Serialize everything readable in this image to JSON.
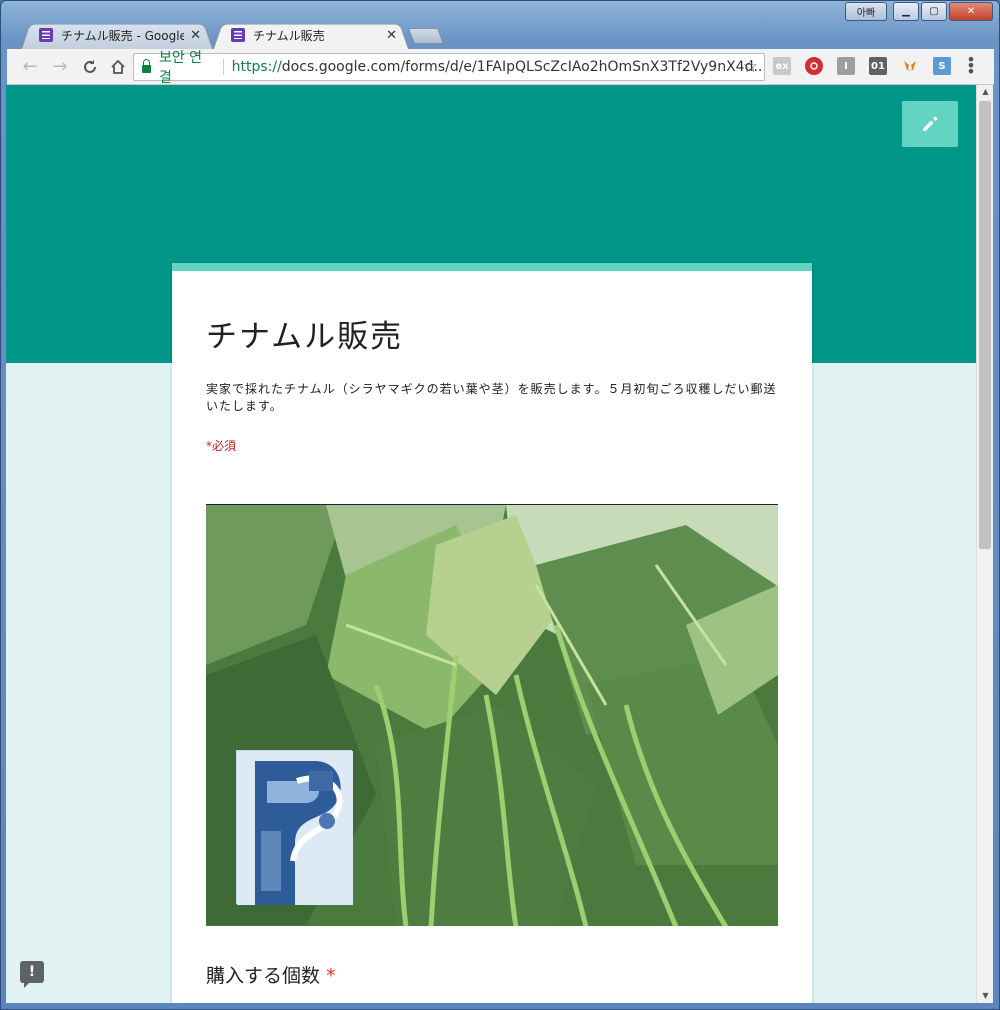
{
  "window": {
    "user_label": "아빠",
    "minimize_label": "▁",
    "maximize_label": "▢",
    "close_label": "✕"
  },
  "tabs": [
    {
      "title": "チナムル販売 - Google フ",
      "active": false
    },
    {
      "title": "チナムル販売",
      "active": true
    }
  ],
  "toolbar": {
    "secure_label": "보안 연결",
    "url_scheme": "https://",
    "url_rest": "docs.google.com/forms/d/e/1FAIpQLScZcIAo2hOmSnX3Tf2Vy9nX4d..."
  },
  "extensions": [
    {
      "name": "ex-icon",
      "label": "ex",
      "color": "#c8c8c8"
    },
    {
      "name": "lastpass-icon",
      "label": "",
      "color": "#d32f2f"
    },
    {
      "name": "i-icon",
      "label": "I",
      "color": "#9e9e9e"
    },
    {
      "name": "01-icon",
      "label": "01",
      "color": "#616161"
    },
    {
      "name": "metamask-icon",
      "label": "",
      "color": "#e8821e"
    },
    {
      "name": "s-icon",
      "label": "S",
      "color": "#5b9bd5"
    }
  ],
  "form": {
    "title": "チナムル販売",
    "description": "実家で採れたチナムル（シラヤマギクの若い葉や茎）を販売します。５月初旬ごろ収穫しだい郵送いたします。",
    "required_note": "*必須",
    "question_title": "購入する個数",
    "question_required": "*"
  },
  "feedback_label": "!"
}
